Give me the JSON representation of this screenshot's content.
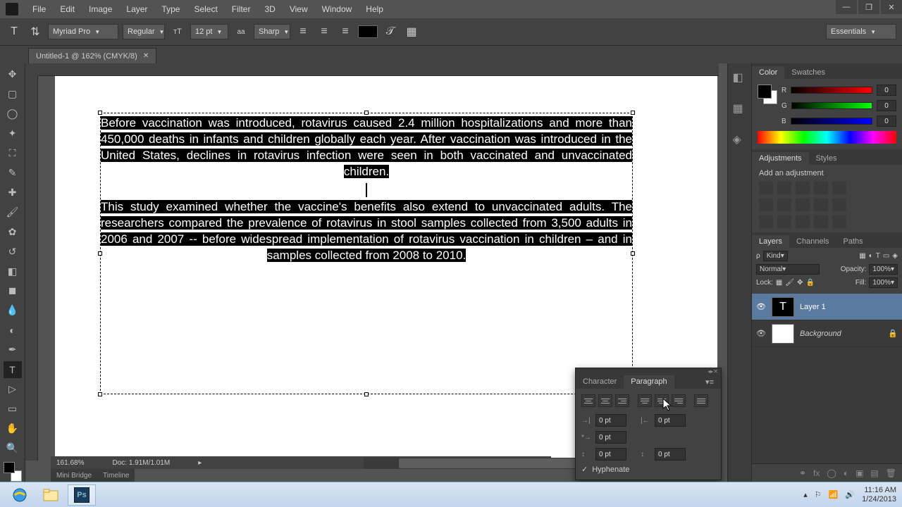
{
  "menu": [
    "File",
    "Edit",
    "Image",
    "Layer",
    "Type",
    "Select",
    "Filter",
    "3D",
    "View",
    "Window",
    "Help"
  ],
  "options": {
    "font": "Myriad Pro",
    "weight": "Regular",
    "size": "12 pt",
    "aa": "Sharp"
  },
  "workspace": "Essentials",
  "doc_tab": "Untitled-1 @ 162% (CMYK/8)",
  "text": {
    "p1": "Before vaccination was introduced, rotavirus caused 2.4 million hospitalizations and more than 450,000 deaths in infants and children globally each year. After vaccination was introduced in the United States, declines in rotavirus infection were seen in both vaccinated and unvaccinated children.",
    "p2": "This study examined whether the vaccine's benefits also extend to unvaccinated adults. The researchers compared the prevalence of rotavirus in stool samples collected from 3,500 adults in 2006 and 2007 -- before widespread implementation of rotavirus vaccination in children – and in samples collected from 2008 to 2010."
  },
  "status": {
    "zoom": "161.68%",
    "doc": "Doc: 1.91M/1.01M"
  },
  "bottom_tabs": [
    "Mini Bridge",
    "Timeline"
  ],
  "color": {
    "r": "0",
    "g": "0",
    "b": "0"
  },
  "panel_tabs": {
    "color": [
      "Color",
      "Swatches"
    ],
    "adj": [
      "Adjustments",
      "Styles"
    ],
    "layers": [
      "Layers",
      "Channels",
      "Paths"
    ]
  },
  "adj_label": "Add an adjustment",
  "layers": {
    "filter": "Kind",
    "blend": "Normal",
    "opacity_label": "Opacity:",
    "opacity": "100%",
    "lock_label": "Lock:",
    "fill_label": "Fill:",
    "fill": "100%",
    "items": [
      {
        "name": "Layer 1",
        "type": "T"
      },
      {
        "name": "Background",
        "type": "bg"
      }
    ]
  },
  "para": {
    "tabs": [
      "Character",
      "Paragraph"
    ],
    "indent_left": "0 pt",
    "indent_right": "0 pt",
    "indent_first": "0 pt",
    "space_before": "0 pt",
    "space_after": "0 pt",
    "hyphenate": "Hyphenate"
  },
  "systray": {
    "time": "11:16 AM",
    "date": "1/24/2013"
  }
}
